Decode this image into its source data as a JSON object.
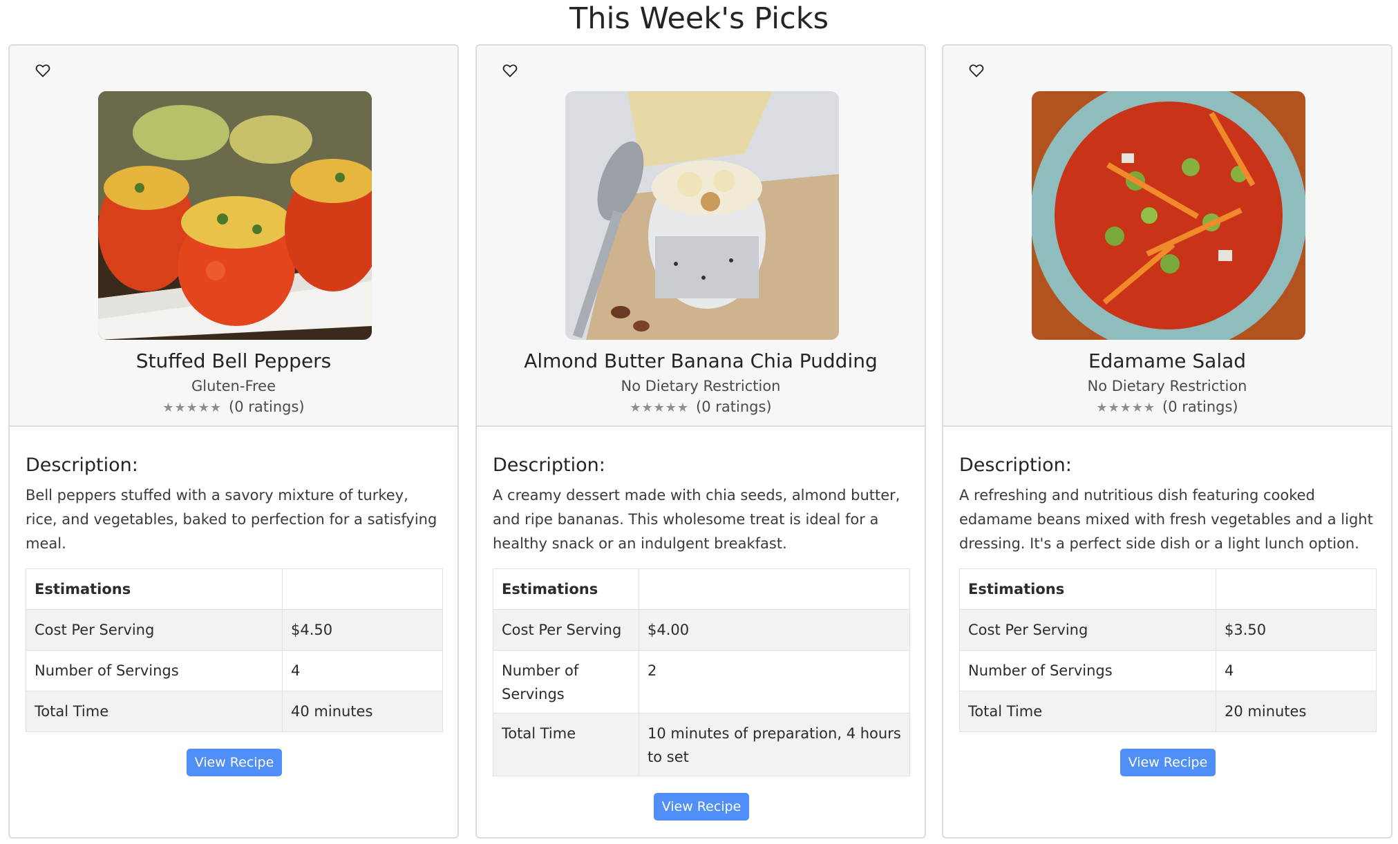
{
  "page": {
    "title": "This Week's Picks"
  },
  "icons": {
    "favorite": "heart-outline-icon"
  },
  "colors": {
    "button": "#4f8ff7",
    "card_top_bg": "#f7f7f7",
    "stars": "#8e8e8e"
  },
  "cards": [
    {
      "name": "Stuffed Bell Peppers",
      "diet": "Gluten-Free",
      "stars": "★★★★★",
      "ratings": "(0 ratings)",
      "description_heading": "Description:",
      "description": "Bell peppers stuffed with a savory mixture of turkey, rice, and vegetables, baked to perfection for a satisfying meal.",
      "table": {
        "header": "Estimations",
        "rows": [
          {
            "label": "Cost Per Serving",
            "value": "$4.50"
          },
          {
            "label": "Number of Servings",
            "value": "4"
          },
          {
            "label": "Total Time",
            "value": "40 minutes"
          }
        ]
      },
      "button": "View Recipe"
    },
    {
      "name": "Almond Butter Banana Chia Pudding",
      "diet": "No Dietary Restriction",
      "stars": "★★★★★",
      "ratings": "(0 ratings)",
      "description_heading": "Description:",
      "description": "A creamy dessert made with chia seeds, almond butter, and ripe bananas. This wholesome treat is ideal for a healthy snack or an indulgent breakfast.",
      "table": {
        "header": "Estimations",
        "rows": [
          {
            "label": "Cost Per Serving",
            "value": "$4.00"
          },
          {
            "label": "Number of Servings",
            "value": "2"
          },
          {
            "label": "Total Time",
            "value": "10 minutes of preparation, 4 hours to set"
          }
        ]
      },
      "button": "View Recipe"
    },
    {
      "name": "Edamame Salad",
      "diet": "No Dietary Restriction",
      "stars": "★★★★★",
      "ratings": "(0 ratings)",
      "description_heading": "Description:",
      "description": "A refreshing and nutritious dish featuring cooked edamame beans mixed with fresh vegetables and a light dressing. It's a perfect side dish or a light lunch option.",
      "table": {
        "header": "Estimations",
        "rows": [
          {
            "label": "Cost Per Serving",
            "value": "$3.50"
          },
          {
            "label": "Number of Servings",
            "value": "4"
          },
          {
            "label": "Total Time",
            "value": "20 minutes"
          }
        ]
      },
      "button": "View Recipe"
    }
  ]
}
